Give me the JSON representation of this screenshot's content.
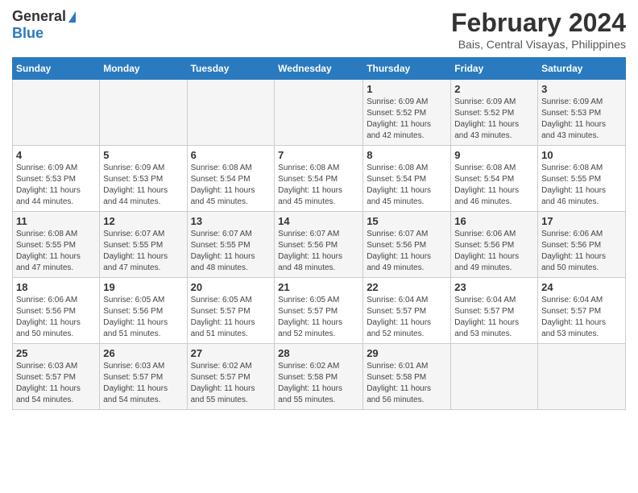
{
  "logo": {
    "line1": "General",
    "line2": "Blue"
  },
  "title": "February 2024",
  "location": "Bais, Central Visayas, Philippines",
  "days_header": [
    "Sunday",
    "Monday",
    "Tuesday",
    "Wednesday",
    "Thursday",
    "Friday",
    "Saturday"
  ],
  "weeks": [
    [
      {
        "day": "",
        "info": ""
      },
      {
        "day": "",
        "info": ""
      },
      {
        "day": "",
        "info": ""
      },
      {
        "day": "",
        "info": ""
      },
      {
        "day": "1",
        "info": "Sunrise: 6:09 AM\nSunset: 5:52 PM\nDaylight: 11 hours\nand 42 minutes."
      },
      {
        "day": "2",
        "info": "Sunrise: 6:09 AM\nSunset: 5:52 PM\nDaylight: 11 hours\nand 43 minutes."
      },
      {
        "day": "3",
        "info": "Sunrise: 6:09 AM\nSunset: 5:53 PM\nDaylight: 11 hours\nand 43 minutes."
      }
    ],
    [
      {
        "day": "4",
        "info": "Sunrise: 6:09 AM\nSunset: 5:53 PM\nDaylight: 11 hours\nand 44 minutes."
      },
      {
        "day": "5",
        "info": "Sunrise: 6:09 AM\nSunset: 5:53 PM\nDaylight: 11 hours\nand 44 minutes."
      },
      {
        "day": "6",
        "info": "Sunrise: 6:08 AM\nSunset: 5:54 PM\nDaylight: 11 hours\nand 45 minutes."
      },
      {
        "day": "7",
        "info": "Sunrise: 6:08 AM\nSunset: 5:54 PM\nDaylight: 11 hours\nand 45 minutes."
      },
      {
        "day": "8",
        "info": "Sunrise: 6:08 AM\nSunset: 5:54 PM\nDaylight: 11 hours\nand 45 minutes."
      },
      {
        "day": "9",
        "info": "Sunrise: 6:08 AM\nSunset: 5:54 PM\nDaylight: 11 hours\nand 46 minutes."
      },
      {
        "day": "10",
        "info": "Sunrise: 6:08 AM\nSunset: 5:55 PM\nDaylight: 11 hours\nand 46 minutes."
      }
    ],
    [
      {
        "day": "11",
        "info": "Sunrise: 6:08 AM\nSunset: 5:55 PM\nDaylight: 11 hours\nand 47 minutes."
      },
      {
        "day": "12",
        "info": "Sunrise: 6:07 AM\nSunset: 5:55 PM\nDaylight: 11 hours\nand 47 minutes."
      },
      {
        "day": "13",
        "info": "Sunrise: 6:07 AM\nSunset: 5:55 PM\nDaylight: 11 hours\nand 48 minutes."
      },
      {
        "day": "14",
        "info": "Sunrise: 6:07 AM\nSunset: 5:56 PM\nDaylight: 11 hours\nand 48 minutes."
      },
      {
        "day": "15",
        "info": "Sunrise: 6:07 AM\nSunset: 5:56 PM\nDaylight: 11 hours\nand 49 minutes."
      },
      {
        "day": "16",
        "info": "Sunrise: 6:06 AM\nSunset: 5:56 PM\nDaylight: 11 hours\nand 49 minutes."
      },
      {
        "day": "17",
        "info": "Sunrise: 6:06 AM\nSunset: 5:56 PM\nDaylight: 11 hours\nand 50 minutes."
      }
    ],
    [
      {
        "day": "18",
        "info": "Sunrise: 6:06 AM\nSunset: 5:56 PM\nDaylight: 11 hours\nand 50 minutes."
      },
      {
        "day": "19",
        "info": "Sunrise: 6:05 AM\nSunset: 5:56 PM\nDaylight: 11 hours\nand 51 minutes."
      },
      {
        "day": "20",
        "info": "Sunrise: 6:05 AM\nSunset: 5:57 PM\nDaylight: 11 hours\nand 51 minutes."
      },
      {
        "day": "21",
        "info": "Sunrise: 6:05 AM\nSunset: 5:57 PM\nDaylight: 11 hours\nand 52 minutes."
      },
      {
        "day": "22",
        "info": "Sunrise: 6:04 AM\nSunset: 5:57 PM\nDaylight: 11 hours\nand 52 minutes."
      },
      {
        "day": "23",
        "info": "Sunrise: 6:04 AM\nSunset: 5:57 PM\nDaylight: 11 hours\nand 53 minutes."
      },
      {
        "day": "24",
        "info": "Sunrise: 6:04 AM\nSunset: 5:57 PM\nDaylight: 11 hours\nand 53 minutes."
      }
    ],
    [
      {
        "day": "25",
        "info": "Sunrise: 6:03 AM\nSunset: 5:57 PM\nDaylight: 11 hours\nand 54 minutes."
      },
      {
        "day": "26",
        "info": "Sunrise: 6:03 AM\nSunset: 5:57 PM\nDaylight: 11 hours\nand 54 minutes."
      },
      {
        "day": "27",
        "info": "Sunrise: 6:02 AM\nSunset: 5:57 PM\nDaylight: 11 hours\nand 55 minutes."
      },
      {
        "day": "28",
        "info": "Sunrise: 6:02 AM\nSunset: 5:58 PM\nDaylight: 11 hours\nand 55 minutes."
      },
      {
        "day": "29",
        "info": "Sunrise: 6:01 AM\nSunset: 5:58 PM\nDaylight: 11 hours\nand 56 minutes."
      },
      {
        "day": "",
        "info": ""
      },
      {
        "day": "",
        "info": ""
      }
    ]
  ]
}
